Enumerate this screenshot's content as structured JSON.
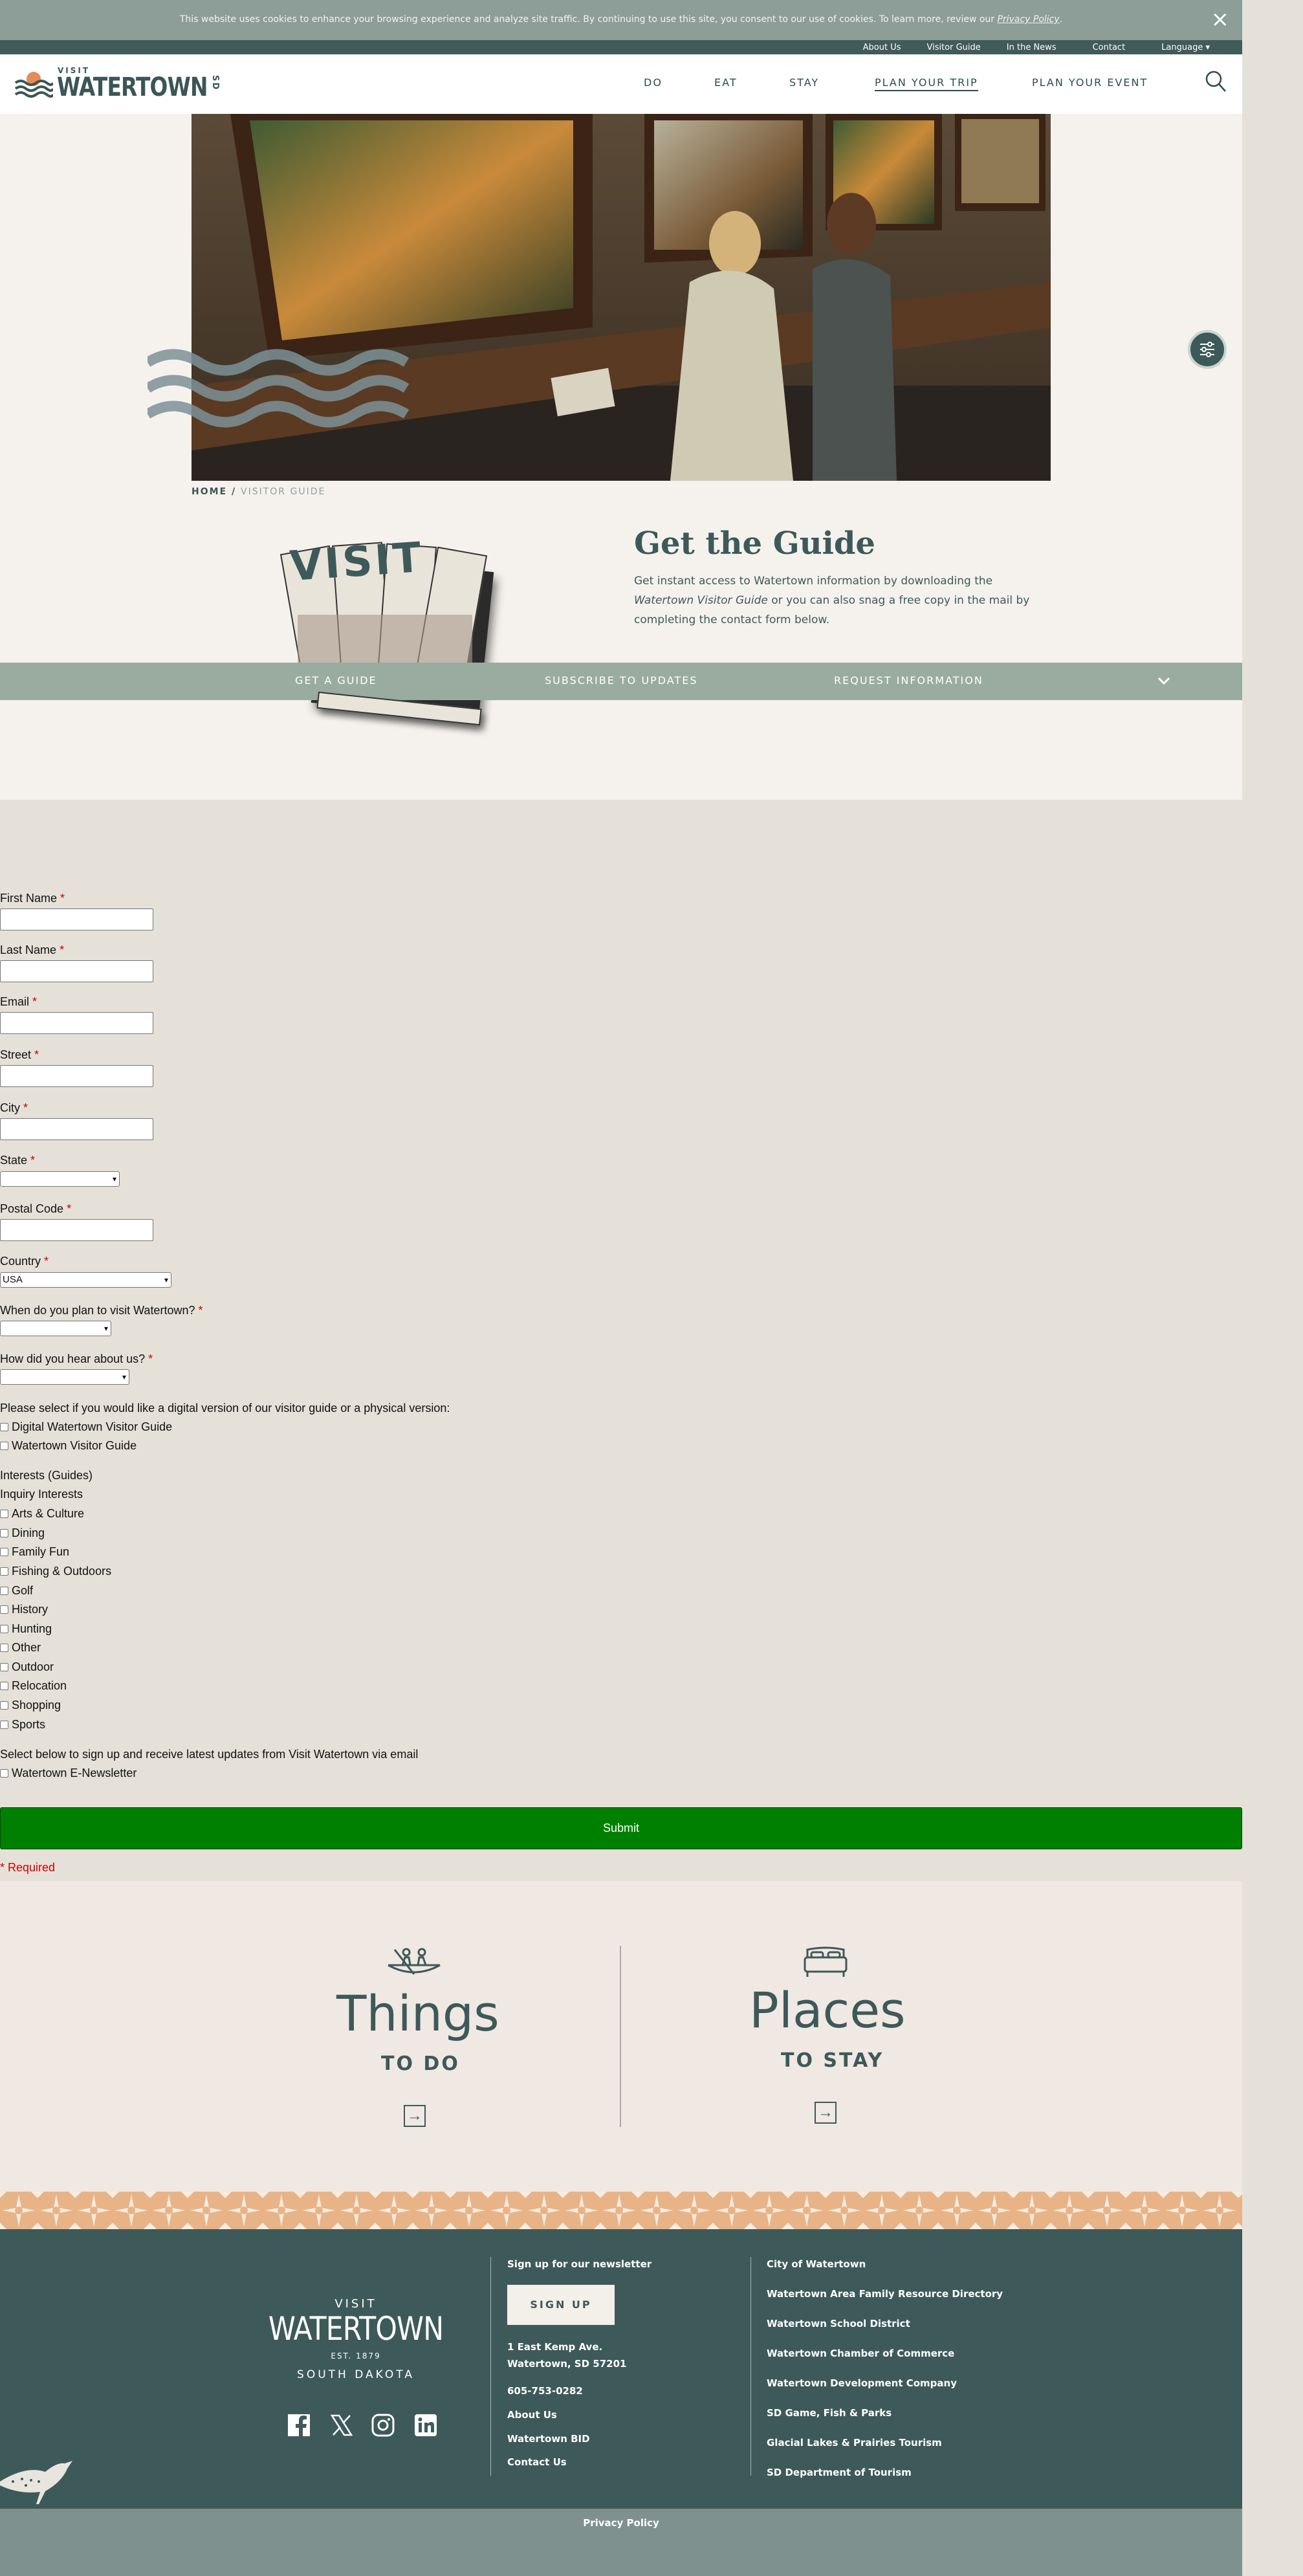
{
  "cookie": {
    "text": "This website uses cookies to enhance your browsing experience and analyze site traffic. By continuing to use this site, you consent to our use of cookies. To learn more, review our ",
    "link": "Privacy Policy",
    "end": ".",
    "close": "×"
  },
  "utility": {
    "links": [
      "About Us",
      "Visitor Guide",
      "In the News",
      "Contact",
      "Language ▾"
    ]
  },
  "logo": {
    "visit": "VISIT",
    "name": "WATERTOWN",
    "sd": "SD"
  },
  "nav": {
    "items": [
      "DO",
      "EAT",
      "STAY",
      "PLAN YOUR TRIP",
      "PLAN YOUR EVENT"
    ]
  },
  "breadcrumb": {
    "home": "HOME",
    "sep": " / ",
    "current": "VISITOR GUIDE"
  },
  "guide": {
    "title": "Get the Guide",
    "desc_1": "Get instant access to Watertown information by downloading the ",
    "desc_em": "Watertown Visitor Guide",
    "desc_2": " or you can also snag a free copy in the mail by completing the contact form below.",
    "cover_text": "VISIT"
  },
  "tabs": [
    "GET A GUIDE",
    "SUBSCRIBE TO UPDATES",
    "REQUEST INFORMATION"
  ],
  "form": {
    "first_name": "First Name",
    "last_name": "Last Name",
    "email": "Email",
    "street": "Street",
    "city": "City",
    "state": "State",
    "postal": "Postal Code",
    "country": "Country",
    "country_value": "USA",
    "when": "When do you plan to visit Watertown?",
    "how": "How did you hear about us?",
    "version_q": "Please select if you would like a digital version of our visitor guide or a physical version:",
    "versions": [
      "Digital Watertown Visitor Guide",
      "Watertown Visitor Guide"
    ],
    "interests_guides": "Interests (Guides)",
    "inquiry_interests": "Inquiry Interests",
    "interests": [
      "Arts & Culture",
      "Dining",
      "Family Fun",
      "Fishing & Outdoors",
      "Golf",
      "History",
      "Hunting",
      "Other",
      "Outdoor",
      "Relocation",
      "Shopping",
      "Sports"
    ],
    "newsletter_q": "Select below to sign up and receive latest updates from Visit Watertown via email",
    "newsletter": "Watertown E-Newsletter",
    "submit": "Submit",
    "required": "* Required",
    "star": "*"
  },
  "promo": {
    "things_big": "Things",
    "things_small": "TO DO",
    "places_big": "Places",
    "places_small": "TO STAY",
    "arrow": "→"
  },
  "footer": {
    "logo_visit": "VISIT",
    "logo_name": "WATERTOWN",
    "logo_est": "EST.  1879",
    "logo_state": "SOUTH DAKOTA",
    "newsletter_title": "Sign up for our newsletter",
    "signup": "SIGN UP",
    "address_1": "1 East Kemp Ave.",
    "address_2": "Watertown, SD 57201",
    "phone": "605-753-0282",
    "links_a": [
      "About Us",
      "Watertown BID",
      "Contact Us"
    ],
    "links_b": [
      "City of Watertown",
      "Watertown Area Family Resource Directory",
      "Watertown School District",
      "Watertown Chamber of Commerce",
      "Watertown Development Company",
      "SD Game, Fish & Parks",
      "Glacial Lakes & Prairies Tourism",
      "SD Department of Tourism"
    ],
    "social": [
      "facebook-icon",
      "x-icon",
      "instagram-icon",
      "linkedin-icon"
    ]
  },
  "bottom": {
    "privacy": "Privacy Policy"
  }
}
